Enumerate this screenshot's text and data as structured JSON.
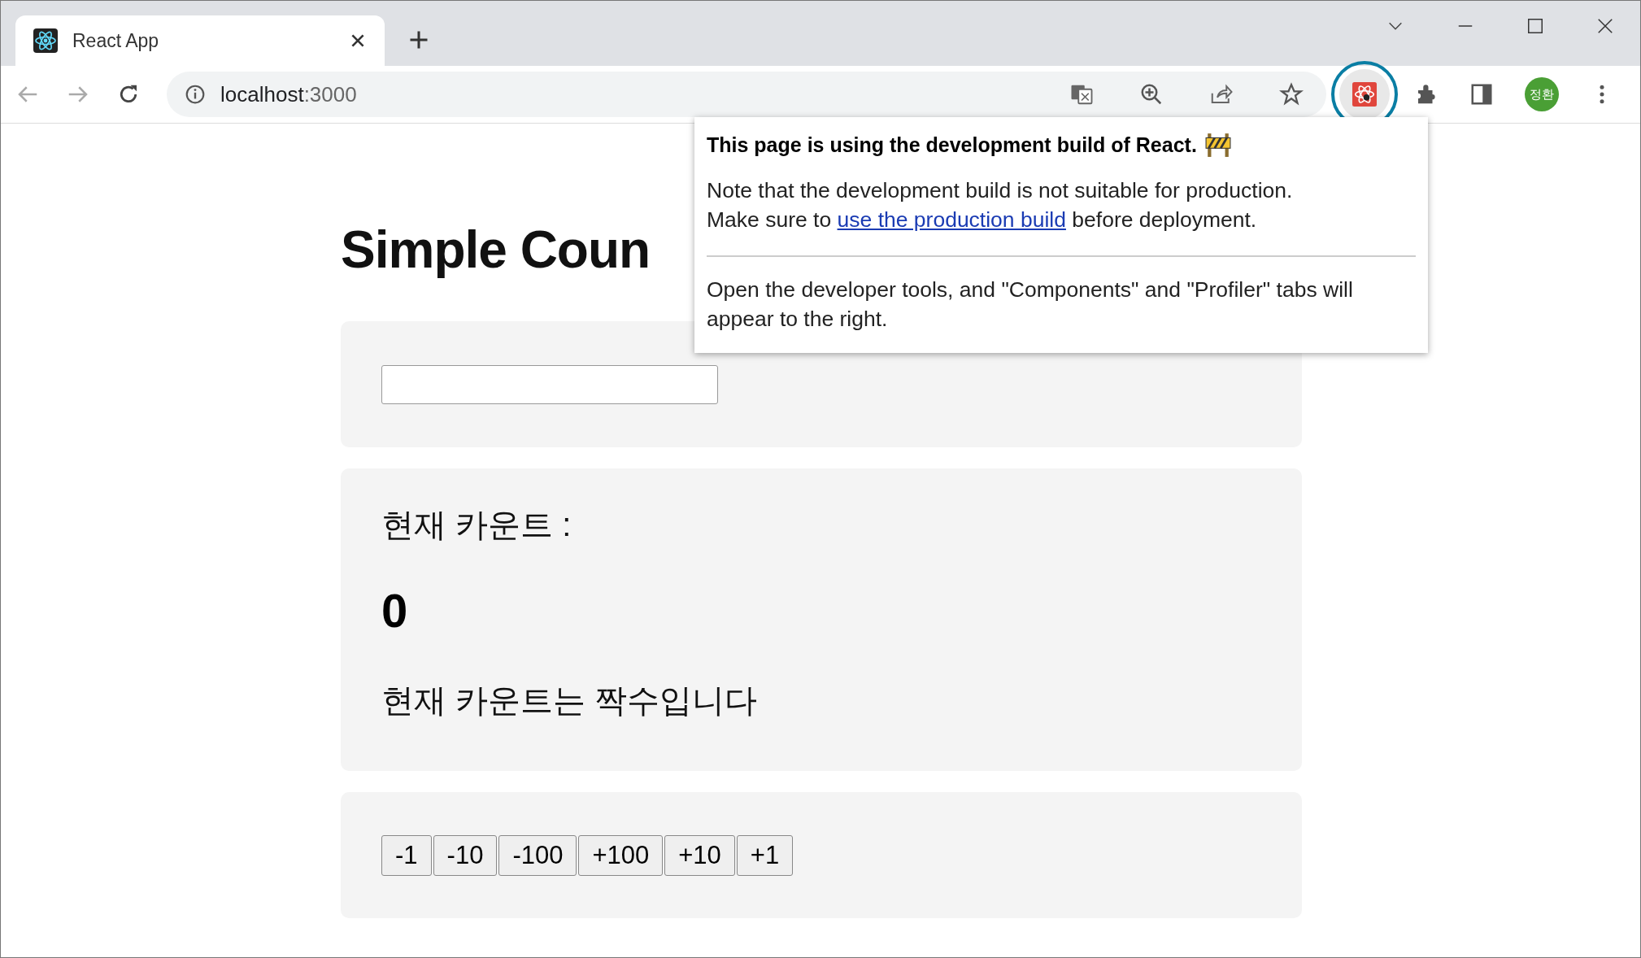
{
  "browser": {
    "tab": {
      "title": "React App",
      "selected": true
    },
    "url": {
      "host": "localhost",
      "port": ":3000"
    },
    "profile": {
      "initials": "정환"
    }
  },
  "page": {
    "heading": "Simple Coun",
    "count_label": "현재 카운트 :",
    "count": "0",
    "parity_text": "현재 카운트는 짝수입니다",
    "buttons": [
      "-1",
      "-10",
      "-100",
      "+100",
      "+10",
      "+1"
    ]
  },
  "popup": {
    "title": "This page is using the development build of React.",
    "note": "Note that the development build is not suitable for production.",
    "before_link": "Make sure to ",
    "link": "use the production build",
    "after_link": " before deployment.",
    "hint": "Open the developer tools, and \"Components\" and \"Profiler\" tabs will appear to the right."
  }
}
